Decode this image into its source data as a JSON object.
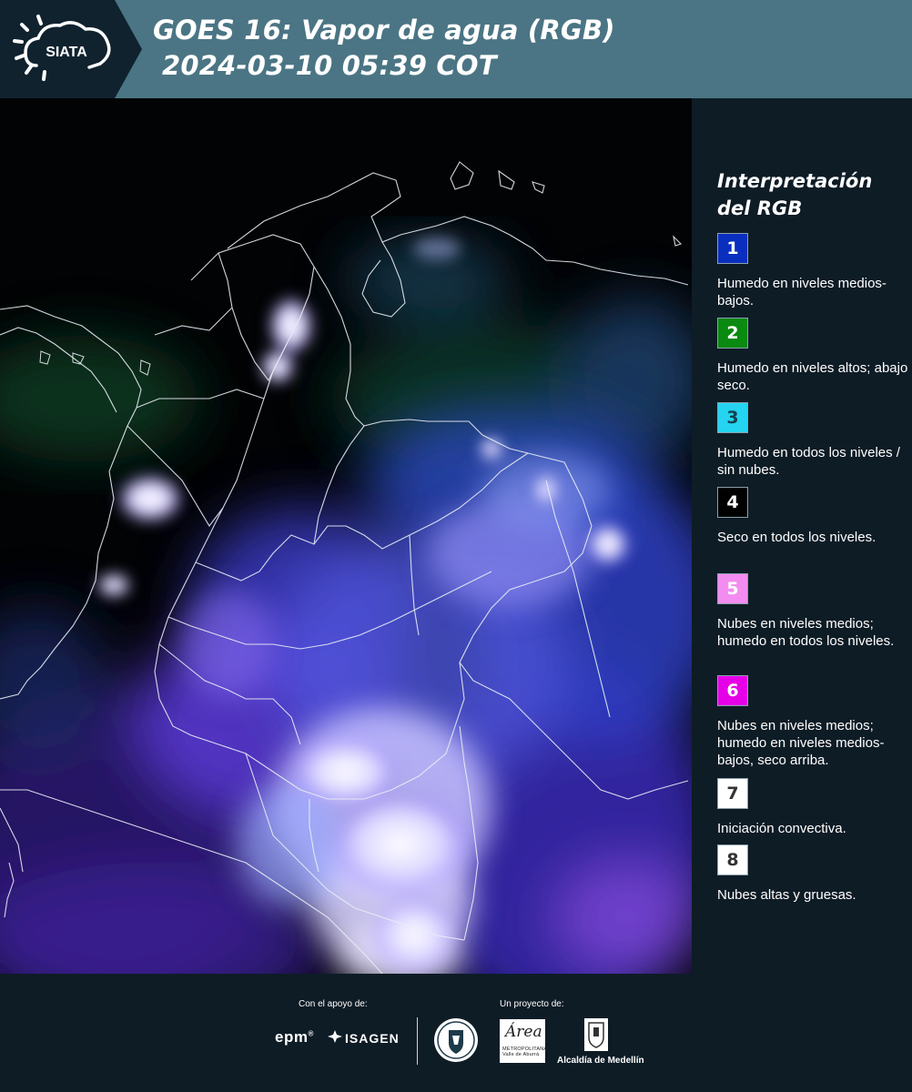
{
  "header": {
    "logo_text": "SIATA",
    "title_line1": "GOES 16: Vapor de agua (RGB)",
    "title_line2": "2024-03-10 05:39 COT",
    "colors": {
      "header_bg": "#4b7584",
      "logo_bg": "#10222e"
    }
  },
  "map": {
    "description_icon": "satellite-water-vapor-rgb-map"
  },
  "legend": {
    "title": "Interpretación del RGB",
    "items": [
      {
        "number": "1",
        "color": "#0a2fbf",
        "text_color": "#ffffff",
        "description": "Humedo en niveles medios-bajos."
      },
      {
        "number": "2",
        "color": "#0a8a10",
        "text_color": "#ffffff",
        "description": "Humedo en niveles altos; abajo seco."
      },
      {
        "number": "3",
        "color": "#25d4f0",
        "text_color": "#13424e",
        "description": "Humedo en todos los niveles / sin nubes."
      },
      {
        "number": "4",
        "color": "#000000",
        "text_color": "#ffffff",
        "description": "Seco en todos los niveles."
      },
      {
        "number": "5",
        "color": "#f38cf0",
        "text_color": "#ffffff",
        "description": "Nubes en niveles medios; humedo en todos los niveles."
      },
      {
        "number": "6",
        "color": "#e600e8",
        "text_color": "#ffffff",
        "description": "Nubes en niveles medios; humedo en niveles medios-bajos, seco arriba."
      },
      {
        "number": "7",
        "color": "#ffffff",
        "text_color": "#333333",
        "description": "Iniciación convectiva."
      },
      {
        "number": "8",
        "color": "#ffffff",
        "text_color": "#333333",
        "description": "Nubes altas y gruesas."
      }
    ]
  },
  "footer": {
    "support_label": "Con el apoyo de:",
    "project_label": "Un proyecto de:",
    "epm": "epm",
    "isagen": "ISAGEN",
    "area_logo_text": "Área",
    "area_logo_subtext": "METROPOLITANA Valle de Aburrá",
    "medellin_label": "Alcaldía de Medellín"
  }
}
